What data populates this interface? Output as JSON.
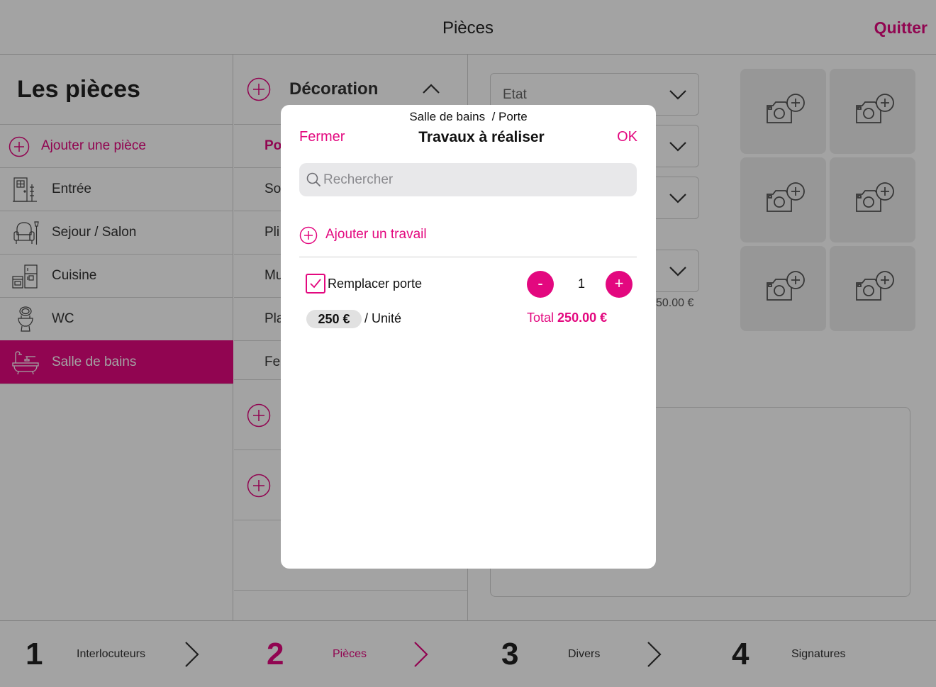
{
  "header": {
    "title": "Pièces",
    "quit_label": "Quitter"
  },
  "sidebar": {
    "heading": "Les pièces",
    "add_label": "Ajouter une pièce",
    "items": [
      {
        "label": "Entrée",
        "icon": "door-icon"
      },
      {
        "label": "Sejour / Salon",
        "icon": "armchair-icon"
      },
      {
        "label": "Cuisine",
        "icon": "kitchen-icon"
      },
      {
        "label": "WC",
        "icon": "toilet-icon"
      },
      {
        "label": "Salle de bains",
        "icon": "bathtub-icon",
        "selected": true
      }
    ]
  },
  "middle": {
    "section_title": "Décoration",
    "rows": [
      "Po",
      "So",
      "Pli",
      "Mu",
      "Pla",
      "Fe"
    ]
  },
  "right": {
    "dropdowns": [
      "Etat",
      "",
      "",
      ""
    ],
    "partial_price": "50.00 €"
  },
  "footer": {
    "steps": [
      {
        "num": "1",
        "label": "Interlocuteurs"
      },
      {
        "num": "2",
        "label": "Pièces",
        "active": true
      },
      {
        "num": "3",
        "label": "Divers"
      },
      {
        "num": "4",
        "label": "Signatures"
      }
    ]
  },
  "modal": {
    "breadcrumb": "Salle de bains  / Porte",
    "close_label": "Fermer",
    "title": "Travaux à réaliser",
    "ok_label": "OK",
    "search_placeholder": "Rechercher",
    "add_work_label": "Ajouter un travail",
    "item": {
      "name": "Remplacer porte",
      "checked": true,
      "minus_label": "-",
      "plus_label": "+",
      "quantity": "1",
      "unit_price": "250 €",
      "unit_label": "/ Unité",
      "total_prefix": "Total",
      "total_value": "250.00 €"
    }
  },
  "colors": {
    "accent": "#e3087f",
    "overlay": "rgba(0,0,0,0.36)"
  }
}
